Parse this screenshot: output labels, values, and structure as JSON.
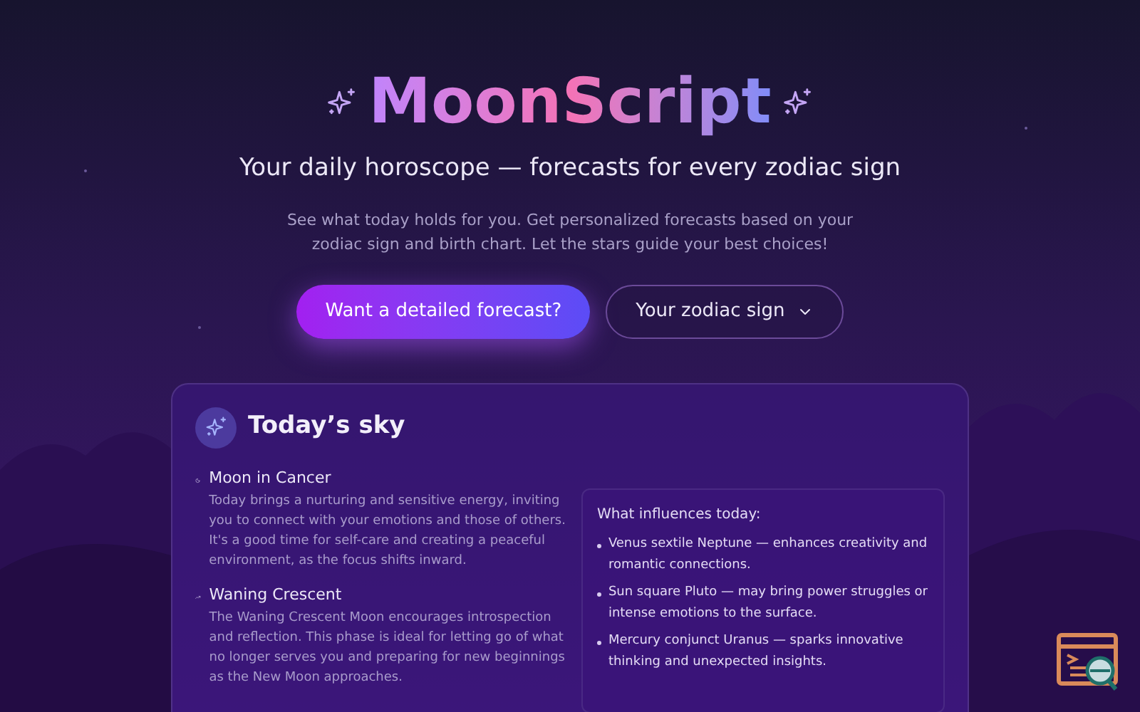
{
  "hero": {
    "title": "MoonScript",
    "subtitle": "Your daily horoscope — forecasts for every zodiac sign",
    "description": "See what today holds for you. Get personalized forecasts based on your zodiac sign and birth chart. Let the stars guide your best choices!"
  },
  "buttons": [
    {
      "label": "Want a detailed forecast?",
      "kind": "primary"
    },
    {
      "label": "Your zodiac sign",
      "kind": "dropdown"
    }
  ],
  "card": {
    "title": "Today’s sky",
    "sections": [
      {
        "kind": "moon",
        "title": "Moon in Cancer",
        "text": "Today brings a nurturing and sensitive energy, inviting you to connect with your emotions and those of others. It's a good time for self-care and creating a peaceful environment, as the focus shifts inward."
      },
      {
        "kind": "trend",
        "title": "Waning Crescent",
        "text": "The Waning Crescent Moon encourages introspection and reflection. This phase is ideal for letting go of what no longer serves you and preparing for new beginnings as the New Moon approaches."
      }
    ],
    "influences": {
      "title": "What influences today:",
      "items": [
        "Venus sextile Neptune — enhances creativity and romantic connections.",
        "Sun square Pluto — may bring power struggles or intense emotions to the surface.",
        "Mercury conjunct Uranus — sparks innovative thinking and unexpected insights."
      ]
    }
  }
}
